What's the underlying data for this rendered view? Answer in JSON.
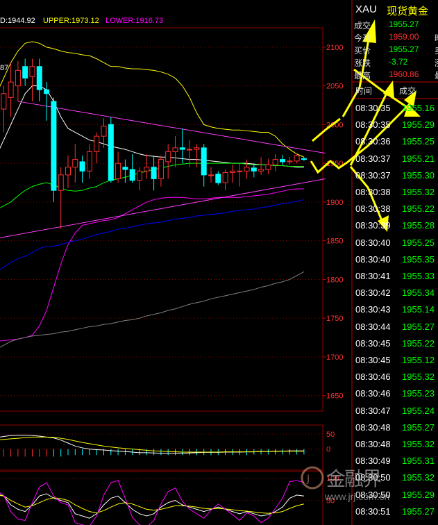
{
  "indicator_header": {
    "mid": "D:1944.92",
    "upper": "UPPER:1973.12",
    "lower": "LOWER:1916.73",
    "mid_color": "#ffffff",
    "upper_color": "#ffff00",
    "lower_color": "#ff00ff",
    "partial_label": "87"
  },
  "quote": {
    "symbol": "XAU",
    "name": "现货黄金",
    "rows": [
      {
        "label": "成交",
        "value": "1955.27",
        "value_color": "#00ff00",
        "extra": ""
      },
      {
        "label": "今开",
        "value": "1959.00",
        "value_color": "#ff3030",
        "extra": "昨"
      },
      {
        "label": "买价",
        "value": "1955.27",
        "value_color": "#00ff00",
        "extra": "卖"
      },
      {
        "label": "涨跌",
        "value": "-3.72",
        "value_color": "#00ff00",
        "extra": "涨"
      },
      {
        "label": "最高",
        "value": "1960.86",
        "value_color": "#ff3030",
        "extra": "最"
      }
    ]
  },
  "ticks": {
    "time_header": "时间",
    "price_header": "成交",
    "rows": [
      {
        "time": "08:30:35",
        "price": "1955.16"
      },
      {
        "time": "08:30:35",
        "price": "1955.29"
      },
      {
        "time": "08:30:36",
        "price": "1955.25"
      },
      {
        "time": "08:30:37",
        "price": "1955.21"
      },
      {
        "time": "08:30:37",
        "price": "1955.30"
      },
      {
        "time": "08:30:38",
        "price": "1955.32"
      },
      {
        "time": "08:30:38",
        "price": "1955.22"
      },
      {
        "time": "08:30:39",
        "price": "1955.28"
      },
      {
        "time": "08:30:40",
        "price": "1955.25"
      },
      {
        "time": "08:30:40",
        "price": "1955.35"
      },
      {
        "time": "08:30:41",
        "price": "1955.33"
      },
      {
        "time": "08:30:42",
        "price": "1955.34"
      },
      {
        "time": "08:30:43",
        "price": "1955.14"
      },
      {
        "time": "08:30:44",
        "price": "1955.27"
      },
      {
        "time": "08:30:45",
        "price": "1955.22"
      },
      {
        "time": "08:30:45",
        "price": "1955.12"
      },
      {
        "time": "08:30:46",
        "price": "1955.32"
      },
      {
        "time": "08:30:46",
        "price": "1955.23"
      },
      {
        "time": "08:30:47",
        "price": "1955.24"
      },
      {
        "time": "08:30:48",
        "price": "1955.27"
      },
      {
        "time": "08:30:48",
        "price": "1955.32"
      },
      {
        "time": "08:30:49",
        "price": "1955.31"
      },
      {
        "time": "08:30:50",
        "price": "1955.32"
      },
      {
        "time": "08:30:50",
        "price": "1955.29"
      },
      {
        "time": "08:30:51",
        "price": "1955.27"
      }
    ],
    "price_color": "#00ff00"
  },
  "watermark": {
    "brand": "金融界",
    "url": "www.jrj.com.cn"
  },
  "chart_data": {
    "type": "candlestick",
    "price_axis": {
      "ticks": [
        2100,
        2050,
        2000,
        1950,
        1900,
        1850,
        1800,
        1750,
        1700,
        1650
      ],
      "range": [
        1630,
        2125
      ]
    },
    "macd_axis": {
      "ticks": [
        50,
        0
      ],
      "range": [
        -70,
        80
      ]
    },
    "kdj_axis": {
      "ticks": [
        100,
        50
      ],
      "range": [
        -10,
        115
      ]
    },
    "candles": [
      {
        "o": 2030,
        "h": 2060,
        "l": 2000,
        "c": 2020
      },
      {
        "o": 2020,
        "h": 2050,
        "l": 1990,
        "c": 2040
      },
      {
        "o": 2035,
        "h": 2080,
        "l": 2010,
        "c": 2055
      },
      {
        "o": 2050,
        "h": 2082,
        "l": 2030,
        "c": 2070
      },
      {
        "o": 2075,
        "h": 2085,
        "l": 2050,
        "c": 2060
      },
      {
        "o": 2062,
        "h": 2085,
        "l": 2030,
        "c": 2075
      },
      {
        "o": 2075,
        "h": 2085,
        "l": 2030,
        "c": 2045
      },
      {
        "o": 2045,
        "h": 2055,
        "l": 2005,
        "c": 2040
      },
      {
        "o": 2030,
        "h": 2035,
        "l": 1900,
        "c": 1915
      },
      {
        "o": 1915,
        "h": 1945,
        "l": 1865,
        "c": 1935
      },
      {
        "o": 1935,
        "h": 1960,
        "l": 1918,
        "c": 1945
      },
      {
        "o": 1945,
        "h": 1975,
        "l": 1925,
        "c": 1955
      },
      {
        "o": 1952,
        "h": 1960,
        "l": 1925,
        "c": 1940
      },
      {
        "o": 1940,
        "h": 1975,
        "l": 1930,
        "c": 1965
      },
      {
        "o": 1965,
        "h": 1990,
        "l": 1950,
        "c": 1985
      },
      {
        "o": 1985,
        "h": 2008,
        "l": 1970,
        "c": 1998
      },
      {
        "o": 2000,
        "h": 2010,
        "l": 1925,
        "c": 1928
      },
      {
        "o": 1930,
        "h": 1965,
        "l": 1925,
        "c": 1950
      },
      {
        "o": 1945,
        "h": 1955,
        "l": 1925,
        "c": 1942
      },
      {
        "o": 1942,
        "h": 1962,
        "l": 1925,
        "c": 1928
      },
      {
        "o": 1928,
        "h": 1945,
        "l": 1915,
        "c": 1940
      },
      {
        "o": 1940,
        "h": 1962,
        "l": 1930,
        "c": 1945
      },
      {
        "o": 1945,
        "h": 1960,
        "l": 1915,
        "c": 1930
      },
      {
        "o": 1930,
        "h": 1960,
        "l": 1920,
        "c": 1955
      },
      {
        "o": 1952,
        "h": 1975,
        "l": 1930,
        "c": 1965
      },
      {
        "o": 1965,
        "h": 1985,
        "l": 1945,
        "c": 1970
      },
      {
        "o": 1970,
        "h": 1995,
        "l": 1950,
        "c": 1968
      },
      {
        "o": 1968,
        "h": 1980,
        "l": 1945,
        "c": 1968
      },
      {
        "o": 1968,
        "h": 1975,
        "l": 1945,
        "c": 1970
      },
      {
        "o": 1970,
        "h": 1975,
        "l": 1920,
        "c": 1935
      },
      {
        "o": 1935,
        "h": 1945,
        "l": 1925,
        "c": 1935
      },
      {
        "o": 1936,
        "h": 1940,
        "l": 1922,
        "c": 1925
      },
      {
        "o": 1925,
        "h": 1942,
        "l": 1915,
        "c": 1938
      },
      {
        "o": 1938,
        "h": 1948,
        "l": 1925,
        "c": 1940
      },
      {
        "o": 1940,
        "h": 1950,
        "l": 1920,
        "c": 1940
      },
      {
        "o": 1940,
        "h": 1955,
        "l": 1930,
        "c": 1945
      },
      {
        "o": 1944,
        "h": 1950,
        "l": 1932,
        "c": 1940
      },
      {
        "o": 1940,
        "h": 1958,
        "l": 1935,
        "c": 1942
      },
      {
        "o": 1942,
        "h": 1956,
        "l": 1936,
        "c": 1948
      },
      {
        "o": 1948,
        "h": 1962,
        "l": 1940,
        "c": 1955
      },
      {
        "o": 1955,
        "h": 1961,
        "l": 1948,
        "c": 1952
      },
      {
        "o": 1952,
        "h": 1958,
        "l": 1948,
        "c": 1953
      },
      {
        "o": 1953,
        "h": 1962,
        "l": 1950,
        "c": 1960
      },
      {
        "o": 1956,
        "h": 1958,
        "l": 1953,
        "c": 1955
      }
    ],
    "series": [
      {
        "color": "#ffff00",
        "values": [
          2040,
          2060,
          2080,
          2095,
          2105,
          2107,
          2105,
          2100,
          2098,
          2095,
          2093,
          2092,
          2090,
          2089,
          2085,
          2080,
          2075,
          2075,
          2073,
          2072,
          2072,
          2071,
          2070,
          2068,
          2065,
          2060,
          2050,
          2035,
          2015,
          2000,
          1997,
          1995,
          1994,
          1993,
          1993,
          1992,
          1991,
          1990,
          1990,
          1985,
          1975,
          1968,
          1962,
          1958
        ]
      },
      {
        "color": "#ffffff",
        "values": [
          1960,
          1980,
          2000,
          2020,
          2040,
          2050,
          2050,
          2045,
          2030,
          2010,
          1995,
          1990,
          1985,
          1980,
          1978,
          1975,
          1972,
          1970,
          1968,
          1965,
          1962,
          1960,
          1959,
          1958,
          1958,
          1957,
          1956,
          1955,
          1955,
          1954,
          1953,
          1952,
          1951,
          1950,
          1950,
          1950,
          1949,
          1948,
          1948,
          1947,
          1947,
          1946,
          1945,
          1945
        ]
      },
      {
        "color": "#00ff00",
        "values": [
          1890,
          1895,
          1900,
          1908,
          1915,
          1920,
          1923,
          1925,
          1922,
          1918,
          1915,
          1914,
          1915,
          1918,
          1920,
          1925,
          1928,
          1930,
          1932,
          1935,
          1937,
          1940,
          1942,
          1944,
          1946,
          1948,
          1949,
          1950,
          1950,
          1950,
          1950,
          1950,
          1950,
          1950,
          1950,
          1949,
          1948,
          1948,
          1948,
          1947,
          1947,
          1946,
          1946,
          1946
        ]
      },
      {
        "color": "#ff00ff",
        "values": [
          1720,
          1721,
          1722,
          1723,
          1725,
          1728,
          1740,
          1760,
          1790,
          1820,
          1845,
          1860,
          1870,
          1872,
          1874,
          1876,
          1877,
          1880,
          1885,
          1890,
          1895,
          1900,
          1903,
          1905,
          1906,
          1906,
          1906,
          1905,
          1904,
          1904,
          1905,
          1906,
          1906,
          1906,
          1906,
          1907,
          1908,
          1909,
          1910,
          1912,
          1914,
          1916,
          1917,
          1917
        ]
      },
      {
        "color": "#0000ff",
        "values": [
          1810,
          1816,
          1822,
          1827,
          1830,
          1835,
          1840,
          1843,
          1843,
          1845,
          1848,
          1850,
          1852,
          1855,
          1858,
          1860,
          1862,
          1865,
          1866,
          1868,
          1870,
          1872,
          1873,
          1874,
          1876,
          1878,
          1879,
          1880,
          1882,
          1883,
          1884,
          1885,
          1886,
          1888,
          1889,
          1890,
          1891,
          1893,
          1894,
          1896,
          1898,
          1899,
          1901,
          1903
        ]
      },
      {
        "color": "#808080",
        "values": [
          1710,
          1715,
          1720,
          1723,
          1725,
          1727,
          1728,
          1729,
          1730,
          1732,
          1733,
          1735,
          1737,
          1739,
          1740,
          1742,
          1743,
          1745,
          1747,
          1748,
          1750,
          1753,
          1755,
          1757,
          1760,
          1762,
          1765,
          1768,
          1770,
          1772,
          1775,
          1777,
          1779,
          1781,
          1783,
          1785,
          1787,
          1790,
          1792,
          1795,
          1797,
          1800,
          1805,
          1810
        ]
      }
    ],
    "trendlines": [
      {
        "color": "#ff40ff",
        "from": {
          "i": 3,
          "v": 2030
        },
        "to": {
          "i": 46,
          "v": 1963
        }
      },
      {
        "color": "#ff40ff",
        "from": {
          "i": 0,
          "v": 1853
        },
        "to": {
          "i": 46,
          "v": 1930
        }
      }
    ],
    "macd": {
      "dif": [
        38,
        42,
        45,
        46,
        46,
        45,
        43,
        40,
        37,
        30,
        20,
        10,
        4,
        0,
        -2,
        -3,
        -5,
        -7,
        -8,
        -10,
        -12,
        -12,
        -13,
        -14,
        -14,
        -14,
        -14,
        -13,
        -12,
        -11,
        -11,
        -11,
        -10,
        -10,
        -10,
        -9,
        -9,
        -8,
        -8,
        -7,
        -7,
        -6,
        -6,
        -6
      ],
      "dea": [
        30,
        32,
        34,
        36,
        38,
        40,
        40,
        40,
        39,
        36,
        32,
        27,
        22,
        18,
        14,
        10,
        7,
        4,
        2,
        0,
        -2,
        -4,
        -6,
        -7,
        -8,
        -9,
        -10,
        -10,
        -10,
        -10,
        -10,
        -10,
        -9,
        -9,
        -9,
        -9,
        -9,
        -8,
        -8,
        -8,
        -7,
        -7,
        -7,
        -7
      ],
      "hist": [
        -25,
        -25,
        -25,
        -25,
        -25,
        -25,
        -25,
        -25,
        -25,
        -25,
        -20,
        -20,
        -20,
        -20,
        -20,
        -20,
        -20,
        -20,
        -20,
        -20,
        -20,
        -20,
        -20,
        -20,
        -20,
        -20,
        -20,
        -20,
        -20,
        -20,
        -20,
        -20,
        -20,
        -20,
        -20,
        -20,
        -18,
        -18,
        -18,
        -18,
        -18,
        -18,
        -18,
        -18
      ]
    },
    "kdj": {
      "k": [
        65,
        60,
        40,
        30,
        25,
        40,
        60,
        65,
        55,
        50,
        45,
        20,
        15,
        10,
        20,
        40,
        55,
        60,
        45,
        30,
        20,
        15,
        20,
        35,
        45,
        50,
        40,
        35,
        30,
        25,
        30,
        35,
        30,
        25,
        20,
        25,
        20,
        15,
        18,
        25,
        35,
        55,
        62,
        60
      ],
      "d": [
        62,
        60,
        50,
        42,
        35,
        38,
        45,
        52,
        56,
        54,
        50,
        40,
        32,
        25,
        22,
        27,
        35,
        42,
        45,
        42,
        36,
        30,
        28,
        30,
        34,
        38,
        38,
        37,
        35,
        32,
        31,
        32,
        31,
        29,
        27,
        26,
        24,
        22,
        21,
        22,
        25,
        32,
        38,
        42
      ],
      "j": [
        72,
        62,
        25,
        8,
        5,
        45,
        80,
        90,
        60,
        45,
        40,
        0,
        -5,
        -8,
        15,
        62,
        90,
        95,
        55,
        12,
        -5,
        -10,
        5,
        42,
        70,
        78,
        48,
        30,
        20,
        10,
        28,
        42,
        30,
        18,
        5,
        22,
        15,
        0,
        10,
        32,
        55,
        92,
        95,
        90
      ]
    },
    "annotations": [
      {
        "type": "arrow",
        "color": "#ffff00",
        "from": [
          450,
          203
        ],
        "to": [
          530,
          45
        ]
      },
      {
        "type": "arrow",
        "color": "#ffff00",
        "from": [
          465,
          244
        ],
        "to": [
          628,
          103
        ]
      }
    ]
  }
}
